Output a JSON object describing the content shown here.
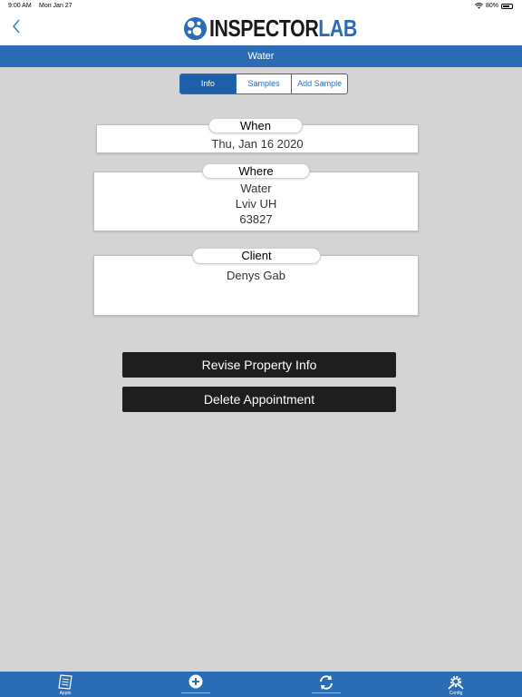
{
  "status_bar": {
    "time": "9:00 AM",
    "date": "Mon Jan 27",
    "battery": "80%",
    "battery_level": 0.8
  },
  "header": {
    "logo_main": "INSPECTOR",
    "logo_accent": "LAB"
  },
  "title_bar": {
    "title": "Water"
  },
  "segments": [
    {
      "label": "Info",
      "active": true
    },
    {
      "label": "Samples",
      "active": false
    },
    {
      "label": "Add Sample",
      "active": false
    }
  ],
  "when": {
    "label": "When",
    "value": "Thu, Jan 16 2020"
  },
  "where": {
    "label": "Where",
    "lines": [
      "Water",
      "Lviv UH",
      "63827"
    ]
  },
  "client": {
    "label": "Client",
    "name": "Denys Gab"
  },
  "actions": {
    "revise": "Revise Property Info",
    "delete": "Delete Appointment"
  },
  "tabbar": {
    "appts": "Appts",
    "new": "",
    "sync": "",
    "config": "Config"
  },
  "colors": {
    "primary": "#2a6db5",
    "active_segment": "#1d5fa8",
    "button": "#1e1e1e",
    "background": "#d4d4d4"
  },
  "icons": {
    "back": "chevron-left-icon",
    "wifi": "wifi-icon",
    "battery": "battery-icon",
    "appts": "clipboard-icon",
    "new": "plus-circle-icon",
    "sync": "refresh-icon",
    "config": "gear-icon"
  }
}
